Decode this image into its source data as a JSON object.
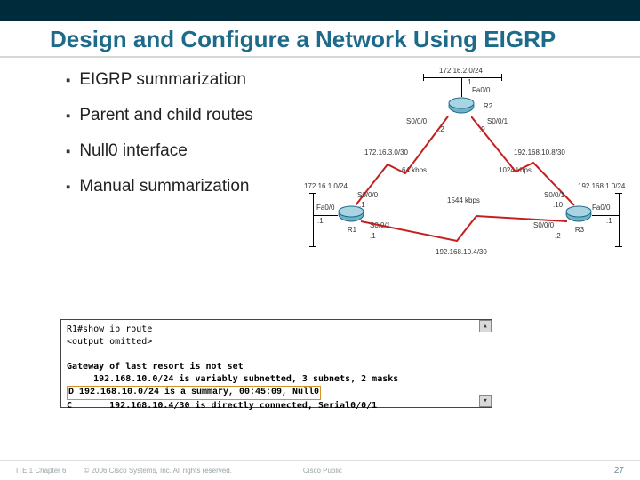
{
  "title": "Design and Configure a Network Using EIGRP",
  "bullets": {
    "b1": "EIGRP summarization",
    "b2": "Parent and child routes",
    "b3": "Null0 interface",
    "b4": "Manual summarization"
  },
  "diagram": {
    "net_top": "172.16.2.0/24",
    "r2_fa00": "Fa0/0",
    "r2_dot1": ".1",
    "r2": "R2",
    "r2_s000": "S0/0/0",
    "r2_s001": "S0/0/1",
    "r2_s000_dot": ".2",
    "r2_s001_dot": ".9",
    "mid_left": "172.16.3.0/30",
    "mid_right": "192.168.10.8/30",
    "bw_left": "64 kbps",
    "bw_right": "1024 kbps",
    "net_left": "172.16.1.0/24",
    "net_right": "192.168.1.0/24",
    "r1": "R1",
    "r3": "R3",
    "r1_fa00": "Fa0/0",
    "r1_s000": "S0/0/0",
    "r1_s001": "S0/0/1",
    "r1_fa00_dot": ".1",
    "r1_s000_dot": ".1",
    "r1_s001_dot": ".1",
    "r3_fa00": "Fa0/0",
    "r3_s000": "S0/0/0",
    "r3_s001": "S0/0/1",
    "r3_fa00_dot": ".1",
    "r3_s000_dot": ".2",
    "r3_s001_dot": ".10",
    "bw_bottom": "1544 kbps",
    "net_bottom": "192.168.10.4/30"
  },
  "terminal": {
    "l1": "R1#show ip route",
    "l2": "<output omitted>",
    "l4": "Gateway of last resort is not set",
    "l5": "     192.168.10.0/24 is variably subnetted, 3 subnets, 2 masks",
    "l6": "D       192.168.10.0/24 is a summary, 00:45:09, Null0",
    "l7": "C       192.168.10.4/30 is directly connected, Serial0/0/1"
  },
  "footer": {
    "chapter": "ITE 1 Chapter 6",
    "copyright": "© 2006 Cisco Systems, Inc. All rights reserved.",
    "label": "Cisco Public",
    "page": "27"
  }
}
